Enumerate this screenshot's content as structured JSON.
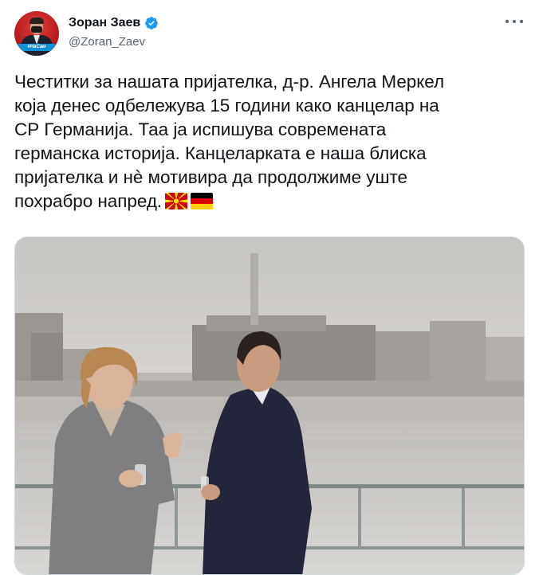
{
  "author": {
    "display_name": "Зоран Заев",
    "handle": "@Zoran_Zaev",
    "verified": true,
    "avatar_banner_text": "#НаСам",
    "avatar_icon": "profile-photo"
  },
  "tweet": {
    "lines": [
      "Честитки за нашата пријателка, д-р. Ангела Меркел",
      "која денес одбележува 15 години како канцелар на",
      "СР Германија. Таа ја испишува современата",
      "германска историја. Канцеларката е наша блиска",
      "пријателка и нè мотивира да продолжиме уште",
      "похрабро напред."
    ],
    "emoji": [
      "flag-north-macedonia",
      "flag-germany"
    ]
  },
  "media": {
    "type": "photo",
    "description_icon": "photo-two-people-on-balcony"
  },
  "colors": {
    "text": "#0f1419",
    "secondary": "#536471",
    "verified": "#1d9bf0",
    "border": "#cfd9de"
  }
}
